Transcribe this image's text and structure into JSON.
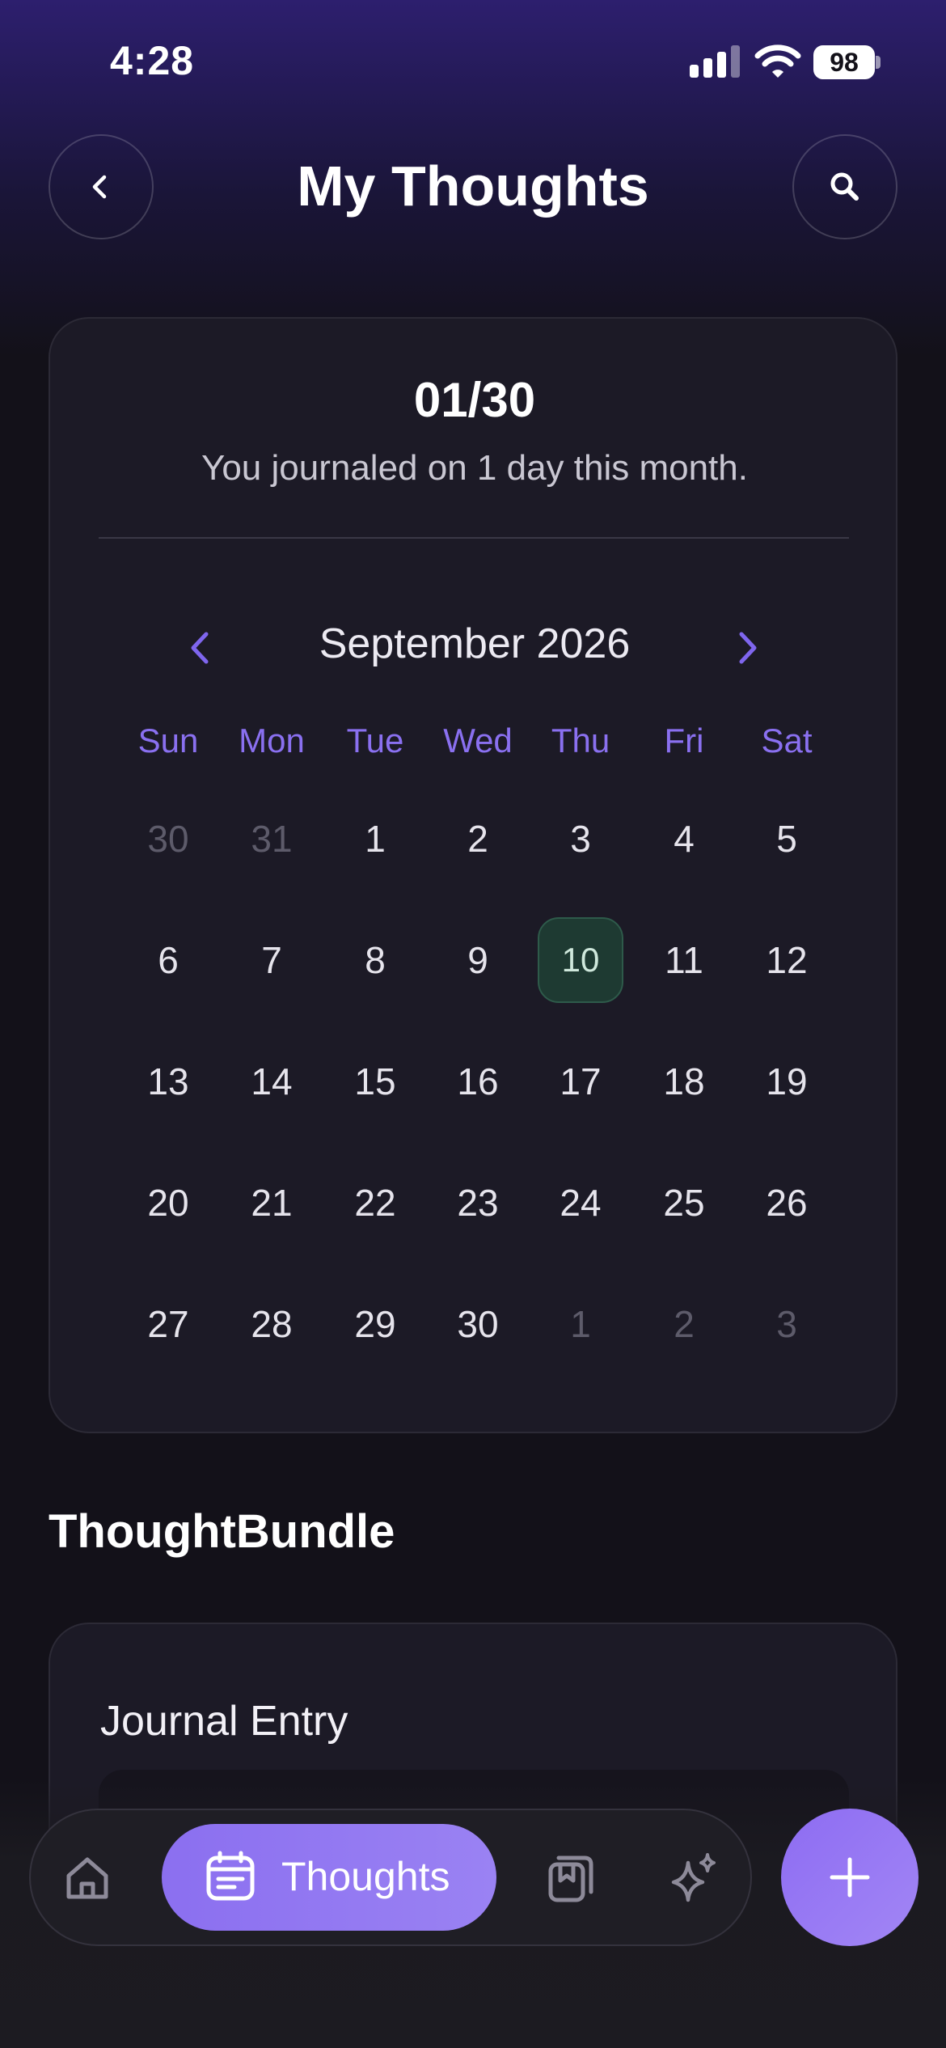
{
  "status_bar": {
    "time": "4:28",
    "battery": "98"
  },
  "header": {
    "title": "My Thoughts",
    "back_icon": "chevron-left-icon",
    "search_icon": "search-icon"
  },
  "summary": {
    "streak": "01/30",
    "subtitle": "You journaled on 1 day this month."
  },
  "calendar": {
    "month_label": "September 2026",
    "weekdays": [
      "Sun",
      "Mon",
      "Tue",
      "Wed",
      "Thu",
      "Fri",
      "Sat"
    ],
    "weeks": [
      [
        "30",
        "31",
        "1",
        "2",
        "3",
        "4",
        "5"
      ],
      [
        "6",
        "7",
        "8",
        "9",
        "10",
        "11",
        "12"
      ],
      [
        "13",
        "14",
        "15",
        "16",
        "17",
        "18",
        "19"
      ],
      [
        "20",
        "21",
        "22",
        "23",
        "24",
        "25",
        "26"
      ],
      [
        "27",
        "28",
        "29",
        "30",
        "1",
        "2",
        "3"
      ]
    ],
    "selected_day": "10"
  },
  "section": {
    "title": "ThoughtBundle"
  },
  "entry": {
    "title": "Journal Entry"
  },
  "tabbar": {
    "items": [
      {
        "name": "home",
        "icon": "home-icon"
      },
      {
        "name": "thoughts",
        "icon": "calendar-icon",
        "label": "Thoughts",
        "active": true
      },
      {
        "name": "library",
        "icon": "book-stack-icon"
      },
      {
        "name": "insights",
        "icon": "sparkle-icon"
      }
    ],
    "fab_icon": "plus-icon"
  },
  "colors": {
    "accent": "#8a70f0",
    "background": "#131119",
    "card": "#1c1a26",
    "selected_day": "#1e3a32"
  }
}
